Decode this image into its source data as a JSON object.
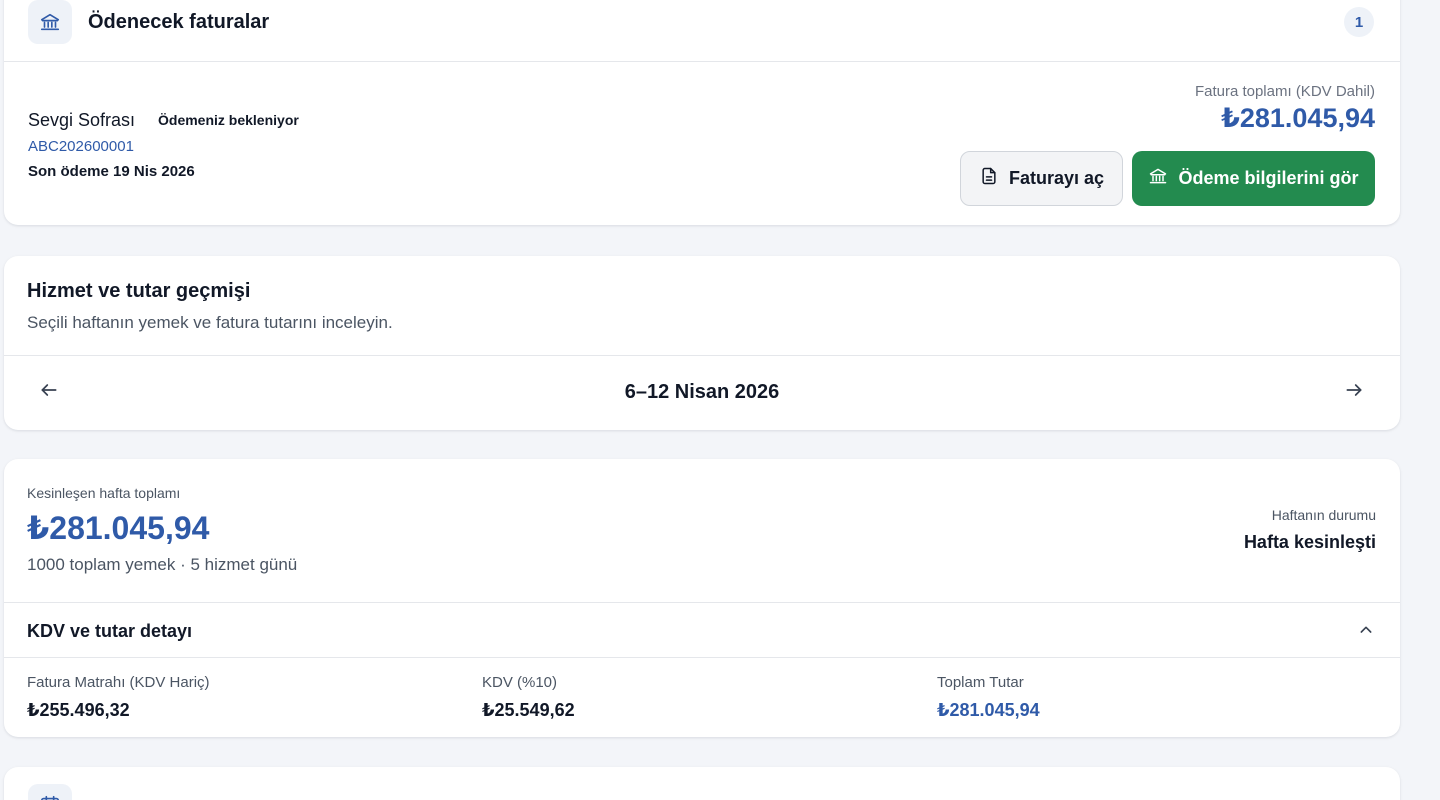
{
  "invoices": {
    "title": "Ödenecek faturalar",
    "count": "1",
    "vendor": "Sevgi Sofrası",
    "status": "Ödemeniz bekleniyor",
    "invoice_code": "ABC202600001",
    "due_date": "Son ödeme 19 Nis 2026",
    "total_label": "Fatura toplamı (KDV Dahil)",
    "total_value": "₺281.045,94",
    "open_button": "Faturayı aç",
    "payment_button": "Ödeme bilgilerini gör"
  },
  "history": {
    "title": "Hizmet ve tutar geçmişi",
    "subtitle": "Seçili haftanın yemek ve fatura tutarını inceleyin.",
    "week_label": "6–12 Nisan 2026"
  },
  "week_summary": {
    "total_label": "Kesinleşen hafta toplamı",
    "total_value": "₺281.045,94",
    "meta": "1000 toplam yemek · 5 hizmet günü",
    "state_label": "Haftanın durumu",
    "state_value": "Hafta kesinleşti",
    "kdv_title": "KDV ve tutar detayı",
    "columns": [
      {
        "label": "Fatura Matrahı (KDV Hariç)",
        "value": "₺255.496,32"
      },
      {
        "label": "KDV (%10)",
        "value": "₺25.549,62"
      },
      {
        "label": "Toplam Tutar",
        "value": "₺281.045,94"
      }
    ]
  },
  "colors": {
    "accent": "#2f5aa8",
    "primary_button": "#238b4f",
    "background": "#f3f5f9"
  }
}
